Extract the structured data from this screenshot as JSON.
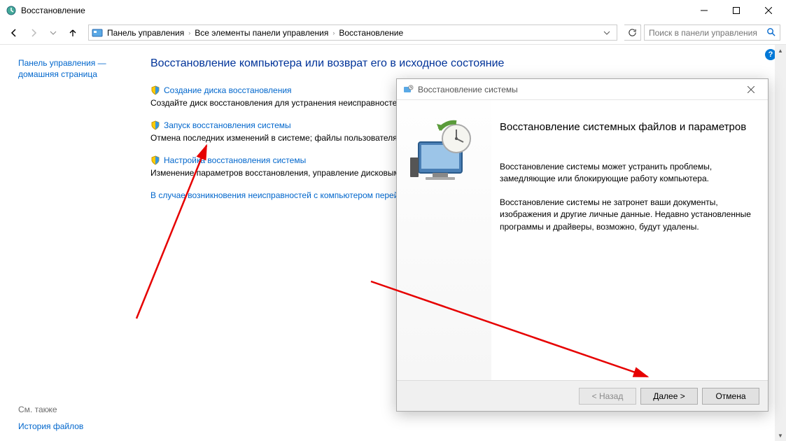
{
  "window": {
    "title": "Восстановление"
  },
  "breadcrumb": {
    "items": [
      "Панель управления",
      "Все элементы панели управления",
      "Восстановление"
    ]
  },
  "search": {
    "placeholder": "Поиск в панели управления"
  },
  "sidebar": {
    "home_link": "Панель управления — домашняя страница"
  },
  "main": {
    "heading": "Восстановление компьютера или возврат его в исходное состояние",
    "options": [
      {
        "label": "Создание диска восстановления",
        "desc": "Создайте диск восстановления для устранения неисправностей, даже когда не удается загрузить компьютер."
      },
      {
        "label": "Запуск восстановления системы",
        "desc": "Отмена последних изменений в системе; файлы пользователя, такие как документы, изображения и музыка, остаются без изменений."
      },
      {
        "label": "Настройка восстановления системы",
        "desc": "Изменение параметров восстановления, управление дисковым пространством и создание или удаление точек восстановления."
      }
    ],
    "note": "В случае возникновения неисправностей с компьютером перейдите к его параметрам и попробуйте изменить их."
  },
  "bottom": {
    "see_also": "См. также",
    "link": "История файлов"
  },
  "dialog": {
    "title": "Восстановление системы",
    "heading": "Восстановление системных файлов и параметров",
    "p1": "Восстановление системы может устранить проблемы, замедляющие или блокирующие работу компьютера.",
    "p2": "Восстановление системы не затронет ваши документы, изображения и другие личные данные. Недавно установленные программы и драйверы, возможно, будут удалены.",
    "back": "< Назад",
    "next": "Далее >",
    "cancel": "Отмена"
  }
}
